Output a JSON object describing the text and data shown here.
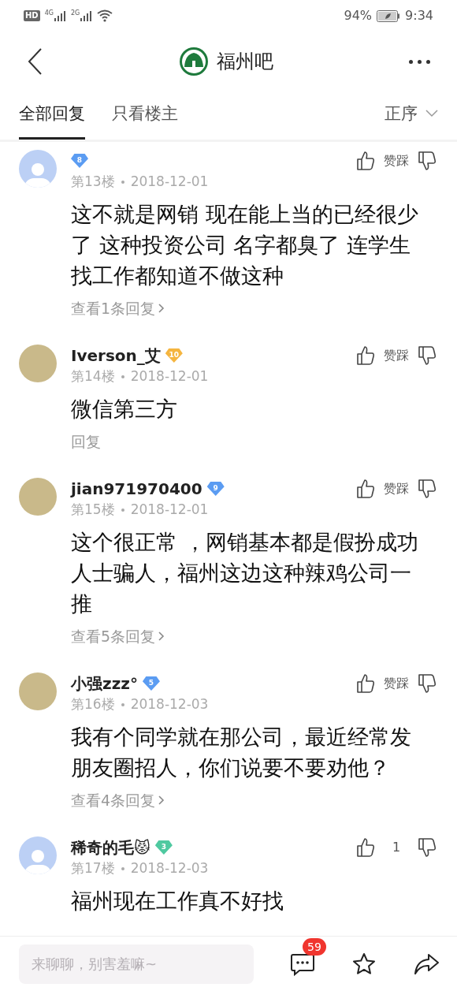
{
  "status_bar": {
    "left": [
      "HD",
      "4G",
      "2G"
    ],
    "battery": "94%",
    "time": "9:34"
  },
  "header": {
    "title": "福州吧"
  },
  "tabs": [
    {
      "label": "全部回复",
      "selected": true
    },
    {
      "label": "只看楼主",
      "selected": false
    }
  ],
  "sort": {
    "label": "正序"
  },
  "comments": [
    {
      "kind": "default",
      "badge": {
        "level": "8",
        "color": "#5b9cf2"
      },
      "floor": "第13楼",
      "date": "2018-12-01",
      "text": "这不就是网销 现在能上当的已经很少了 这种投资公司 名字都臭了 连学生找工作都知道不做这种",
      "vote": "赞踩",
      "replies": "查看1条回复",
      "replies_arrow": true
    },
    {
      "kind": "photo",
      "name": "Iverson_艾",
      "badge": {
        "level": "10",
        "color": "#f5b53f"
      },
      "floor": "第14楼",
      "date": "2018-12-01",
      "text": "微信第三方",
      "vote": "赞踩",
      "replies": "回复",
      "replies_arrow": false
    },
    {
      "kind": "photo",
      "name": "jian971970400",
      "badge": {
        "level": "9",
        "color": "#5b9cf2"
      },
      "floor": "第15楼",
      "date": "2018-12-01",
      "text": "这个很正常 ，网销基本都是假扮成功人士骗人，福州这边这种辣鸡公司一推",
      "vote": "赞踩",
      "replies": "查看5条回复",
      "replies_arrow": true
    },
    {
      "kind": "photo",
      "name": "小强zzz°",
      "badge": {
        "level": "5",
        "color": "#5b9cf2"
      },
      "floor": "第16楼",
      "date": "2018-12-03",
      "text": "我有个同学就在那公司，最近经常发朋友圈招人，你们说要不要劝他？",
      "vote": "赞踩",
      "replies": "查看4条回复",
      "replies_arrow": true
    },
    {
      "kind": "default",
      "name": "稀奇的毛😾",
      "badge": {
        "level": "3",
        "color": "#4fc9a0"
      },
      "floor": "第17楼",
      "date": "2018-12-03",
      "text": "福州现在工作真不好找",
      "vote": "1"
    }
  ],
  "bottom_bar": {
    "placeholder": "来聊聊，别害羞嘛~",
    "comment_count": "59"
  }
}
